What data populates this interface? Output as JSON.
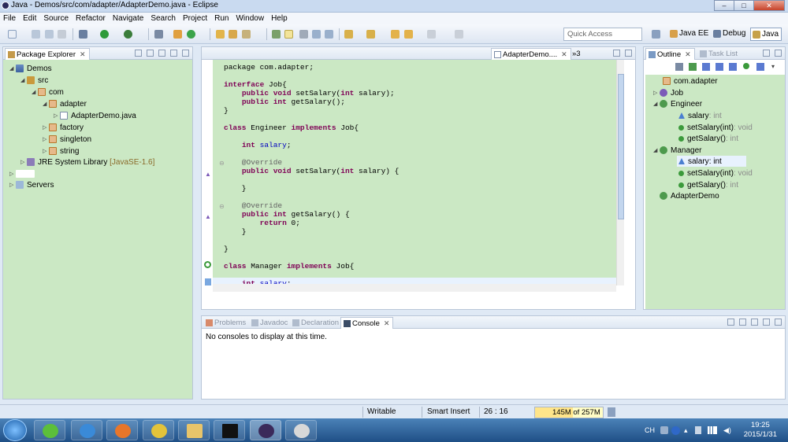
{
  "window": {
    "title": "Java - Demos/src/com/adapter/AdapterDemo.java - Eclipse"
  },
  "menu": [
    "File",
    "Edit",
    "Source",
    "Refactor",
    "Navigate",
    "Search",
    "Project",
    "Run",
    "Window",
    "Help"
  ],
  "toolbar": {
    "quick_access_placeholder": "Quick Access",
    "perspectives": [
      "Java EE",
      "Debug",
      "Java"
    ],
    "active_perspective": "Java"
  },
  "package_explorer": {
    "tab_label": "Package Explorer",
    "tree": [
      {
        "label": "Demos",
        "icon": "project-icon"
      },
      {
        "label": "src",
        "icon": "source-folder-icon"
      },
      {
        "label": "com",
        "icon": "package-icon"
      },
      {
        "label": "adapter",
        "icon": "package-icon"
      },
      {
        "label": "AdapterDemo.java",
        "icon": "java-file-icon"
      },
      {
        "label": "factory",
        "icon": "package-icon"
      },
      {
        "label": "singleton",
        "icon": "package-icon"
      },
      {
        "label": "string",
        "icon": "package-icon"
      },
      {
        "label": "JRE System Library",
        "suffix": "[JavaSE-1.6]",
        "icon": "library-icon"
      },
      {
        "label": "Servers",
        "icon": "server-folder-icon"
      }
    ]
  },
  "editor": {
    "active_tab": "AdapterDemo....",
    "overflow_count": "»3",
    "code_lines": [
      "package com.adapter;",
      "",
      "interface Job{",
      "    public void setSalary(int salary);",
      "    public int getSalary();",
      "}",
      "",
      "class Engineer implements Job{",
      "",
      "    int salary;",
      "",
      "    @Override",
      "    public void setSalary(int salary) {",
      "",
      "    }",
      "",
      "    @Override",
      "    public int getSalary() {",
      "        return 0;",
      "    }",
      "",
      "}",
      "",
      "class Manager implements Job{",
      "",
      "    int salary;"
    ]
  },
  "outline": {
    "tab_label": "Outline",
    "tab2_label": "Task List",
    "tree": [
      {
        "label": "com.adapter",
        "type": ""
      },
      {
        "label": "Job",
        "type": ""
      },
      {
        "label": "Engineer",
        "type": ""
      },
      {
        "label": "salary",
        "type": " : int"
      },
      {
        "label": "setSalary(int)",
        "type": " : void"
      },
      {
        "label": "getSalary()",
        "type": " : int"
      },
      {
        "label": "Manager",
        "type": ""
      },
      {
        "label": "salary",
        "type": " : int"
      },
      {
        "label": "setSalary(int)",
        "type": " : void"
      },
      {
        "label": "getSalary()",
        "type": " : int"
      },
      {
        "label": "AdapterDemo",
        "type": ""
      }
    ]
  },
  "bottom": {
    "tabs": [
      "Problems",
      "Javadoc",
      "Declaration",
      "Console"
    ],
    "active_tab": "Console",
    "message": "No consoles to display at this time."
  },
  "status": {
    "writable": "Writable",
    "insert_mode": "Smart Insert",
    "position": "26 : 16",
    "heap": "145M of 257M",
    "heap_fraction": 0.56
  },
  "taskbar": {
    "lang": "CH",
    "time": "19:25",
    "date": "2015/1/31"
  },
  "colors": {
    "editor_bg": "#cbe8c4",
    "keyword": "#7f0055",
    "field": "#0000c0"
  }
}
